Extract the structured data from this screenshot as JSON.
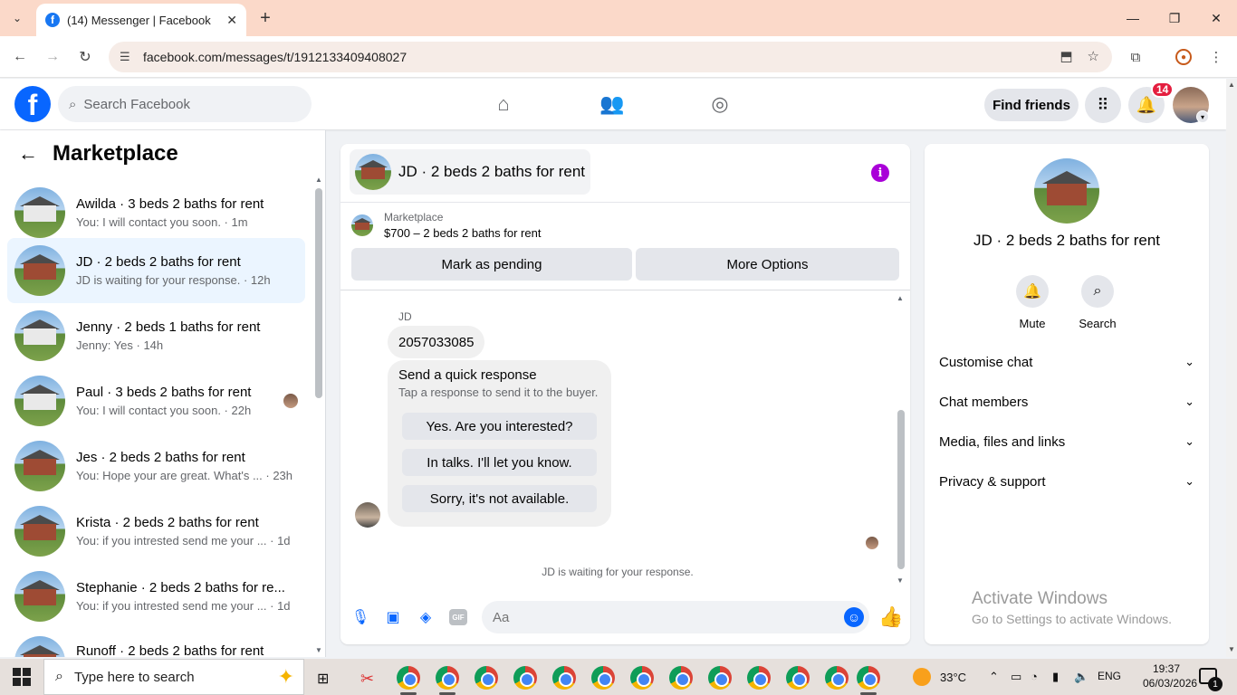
{
  "browser": {
    "tab_title": "(14) Messenger | Facebook",
    "favicon": "f",
    "new_tab": "+",
    "url": "facebook.com/messages/t/1912133409408027",
    "window_controls": {
      "minimize": "—",
      "restore": "❐",
      "close": "✕"
    }
  },
  "fb": {
    "logo": "f",
    "search_placeholder": "Search Facebook",
    "find_friends": "Find friends",
    "notification_count": "14"
  },
  "left_panel": {
    "title": "Marketplace",
    "conversations": [
      {
        "name": "Awilda · 3 beds 2 baths for rent",
        "preview": "You: I will contact you soon. · 1m"
      },
      {
        "name": "JD · 2 beds 2 baths for rent",
        "preview": "JD is waiting for your response. · 12h"
      },
      {
        "name": "Jenny · 2 beds 1 baths for rent",
        "preview": "Jenny: Yes · 14h"
      },
      {
        "name": "Paul · 3 beds 2 baths for rent",
        "preview": "You: I will contact you soon. · 22h"
      },
      {
        "name": "Jes · 2 beds 2 baths for rent",
        "preview": "You: Hope your are great. What's ...  · 23h"
      },
      {
        "name": "Krista · 2 beds 2 baths for rent",
        "preview": "You: if you intrested send me your ...  · 1d"
      },
      {
        "name": "Stephanie · 2 beds 2 baths for re...",
        "preview": "You: if you intrested send me your ...  · 1d"
      },
      {
        "name": "Runoff · 2 beds 2 baths for rent",
        "preview": ""
      }
    ]
  },
  "chat": {
    "title": "JD · 2 beds 2 baths for rent",
    "info_icon": "i",
    "marketplace_label": "Marketplace",
    "listing": "$700 – 2 beds 2 baths for rent",
    "mark_pending": "Mark as pending",
    "more_options": "More Options",
    "sender": "JD",
    "message": "2057033085",
    "quick_title": "Send a quick response",
    "quick_subtitle": "Tap a response to send it to the buyer.",
    "quick_responses": [
      "Yes. Are you interested?",
      "In talks. I'll let you know.",
      "Sorry, it's not available."
    ],
    "waiting": "JD is waiting for your response.",
    "composer_placeholder": "Aa",
    "gif_label": "GIF"
  },
  "right_panel": {
    "title": "JD · 2 beds 2 baths for rent",
    "mute": "Mute",
    "search": "Search",
    "rows": [
      "Customise chat",
      "Chat members",
      "Media, files and links",
      "Privacy & support"
    ]
  },
  "watermark": {
    "line1": "Activate Windows",
    "line2": "Go to Settings to activate Windows."
  },
  "taskbar": {
    "search_placeholder": "Type here to search",
    "temperature": "33°C",
    "language": "ENG",
    "time": "19:37",
    "date": "06/03/2026",
    "notif_count": "1"
  },
  "colors": {
    "fb_blue": "#0866ff",
    "active_row": "#ebf5ff",
    "badge_red": "#e41e3f",
    "info_purple": "#a900d8"
  }
}
